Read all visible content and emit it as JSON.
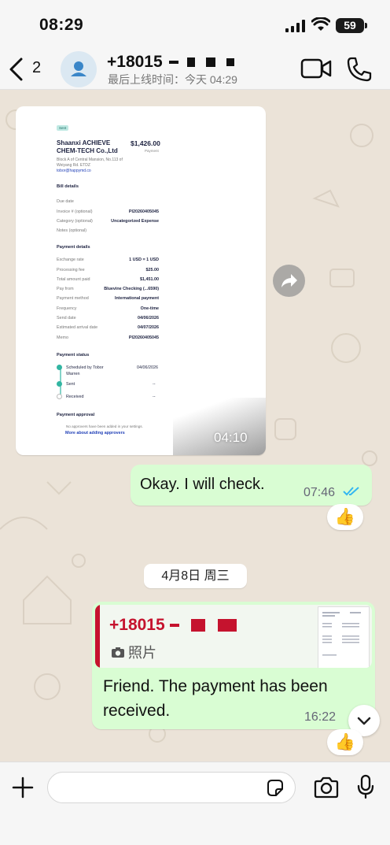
{
  "status_bar": {
    "time": "08:29",
    "battery": "59"
  },
  "header": {
    "back_count": "2",
    "contact_name": "+18015",
    "last_seen": "最后上线时间：今天 04:29"
  },
  "document_message": {
    "doc": {
      "badge": "Sent",
      "business_name": "Shaanxi ACHIEVE CHEM-TECH Co.,Ltd",
      "address": "Block A of Central Mansion, No.113 of Weiyang Rd. ETDZ",
      "email": "tobor@happymd.co",
      "amount": "$1,426.00",
      "amount_label": "Payment",
      "bill_details_title": "Bill details",
      "bill_rows": [
        {
          "label": "Due date",
          "value": ""
        },
        {
          "label": "Invoice # (optional)",
          "value": "PI20260405045"
        },
        {
          "label": "Category (optional)",
          "value": "Uncategorized Expense"
        },
        {
          "label": "Notes (optional)",
          "value": ""
        }
      ],
      "payment_details_title": "Payment details",
      "payment_rows": [
        {
          "label": "Exchange rate",
          "value": "1 USD = 1 USD"
        },
        {
          "label": "Processing fee",
          "value": "$25.00"
        },
        {
          "label": "Total amount paid",
          "value": "$1,451.00"
        },
        {
          "label": "Pay from",
          "value": "Bluevine Checking (...6590)"
        },
        {
          "label": "Payment method",
          "value": "International payment"
        },
        {
          "label": "Frequency",
          "value": "One-time"
        },
        {
          "label": "Send date",
          "value": "04/06/2026"
        },
        {
          "label": "Estimated arrival date",
          "value": "04/07/2026"
        },
        {
          "label": "Memo",
          "value": "PI20260405045"
        }
      ],
      "payment_status_title": "Payment status",
      "status_steps": [
        {
          "label": "Scheduled by Tobor",
          "label2": "Warren",
          "value": "04/06/2026"
        },
        {
          "label": "Sent",
          "label2": "",
          "value": "--"
        },
        {
          "label": "Received",
          "label2": "",
          "value": "--"
        }
      ],
      "approval_title": "Payment approval",
      "approval_text": "No approvers have been added in your settings.",
      "approval_link": "More about adding approvers"
    },
    "time": "04:10"
  },
  "outgoing_message": {
    "text": "Okay. I will check.",
    "time": "07:46",
    "reaction": "👍"
  },
  "date_divider": "4月8日 周三",
  "reply_message": {
    "quoted_name": "+18015",
    "quoted_type": "照片",
    "text": "Friend. The payment has been received.",
    "time": "16:22",
    "reaction": "👍"
  },
  "colors": {
    "outgoing_bubble": "#d9fdd3",
    "quote_accent": "#c5132e",
    "read_check": "#34b7f1"
  },
  "icons": [
    "back-chevron-icon",
    "person-icon",
    "video-icon",
    "phone-icon",
    "share-icon",
    "double-check-icon",
    "camera-icon",
    "chevron-down-icon",
    "plus-icon",
    "sticker-icon",
    "mic-icon"
  ]
}
